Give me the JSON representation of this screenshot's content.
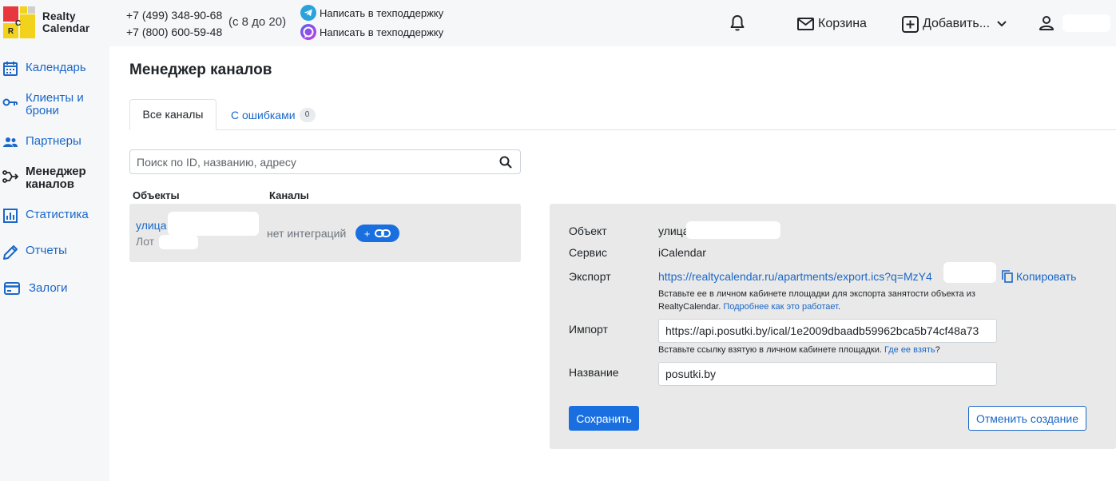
{
  "brand": {
    "name_line1": "Realty",
    "name_line2": "Calendar",
    "logo_letters": [
      "C",
      "R"
    ]
  },
  "header": {
    "phone1": "+7 (499) 348-90-68",
    "phone2": "+7 (800) 600-59-48",
    "hours": "(с 8 до 20)",
    "support_telegram": "Написать в техподдержку",
    "support_viber": "Написать в техподдержку",
    "cart_label": "Корзина",
    "add_label": "Добавить..."
  },
  "sidebar": {
    "items": [
      {
        "label": "Календарь",
        "icon": "calendar-icon"
      },
      {
        "label": "Клиенты и брони",
        "icon": "key-icon"
      },
      {
        "label": "Партнеры",
        "icon": "users-icon"
      },
      {
        "label": "Менеджер каналов",
        "icon": "channels-icon",
        "active": true
      },
      {
        "label": "Статистика",
        "icon": "chart-icon"
      },
      {
        "label": "Отчеты",
        "icon": "pencil-icon"
      },
      {
        "label": "Залоги",
        "icon": "card-icon"
      }
    ]
  },
  "main": {
    "title": "Менеджер каналов",
    "tabs": [
      {
        "label": "Все каналы",
        "active": true
      },
      {
        "label": "С ошибками",
        "badge": "0"
      }
    ],
    "search_placeholder": "Поиск по ID, названию, адресу",
    "col_objects": "Объекты",
    "col_channels": "Каналы",
    "object": {
      "name": "улица",
      "lot": "Лот",
      "no_integrations": "нет интеграций",
      "link_button_plus": "+"
    }
  },
  "form": {
    "object_label": "Объект",
    "object_value": "улица",
    "service_label": "Сервис",
    "service_value": "iCalendar",
    "export_label": "Экспорт",
    "export_url": "https://realtycalendar.ru/apartments/export.ics?q=MzY4",
    "copy_label": "Копировать",
    "export_help": "Вставьте ее в личном кабинете площадки для экспорта занятости объекта из RealtyCalendar.",
    "export_help_link": "Подробнее как это работает",
    "import_label": "Импорт",
    "import_value": "https://api.posutki.by/ical/1e2009dbaadb59962bca5b74cf48a73",
    "import_help": "Вставьте ссылку взятую в личном кабинете площадки.",
    "import_help_link": "Где ее взять",
    "name_label": "Название",
    "name_value": "posutki.by",
    "save_label": "Сохранить",
    "cancel_label": "Отменить создание"
  },
  "colors": {
    "accent": "#1a6fe0",
    "link": "#1a67c7",
    "panel": "#e9e9e9",
    "sidebar": "#f6f7f9"
  }
}
